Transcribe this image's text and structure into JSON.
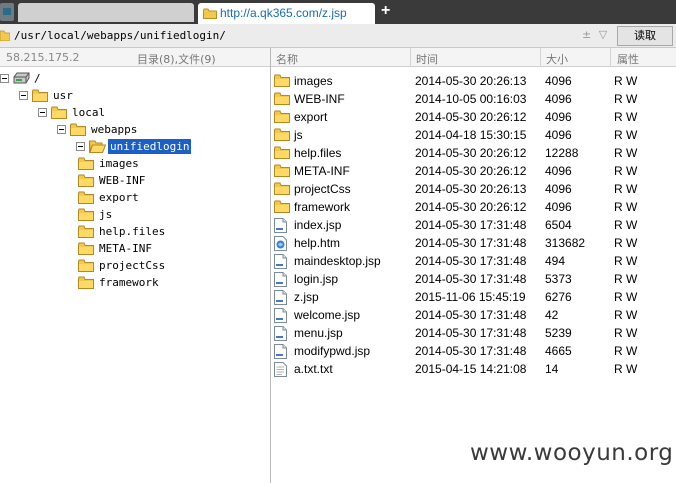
{
  "tabs": {
    "active_url": "http://a.qk365.com/z.jsp",
    "new_tab_symbol": "+"
  },
  "address": {
    "path": "/usr/local/webapps/unifiedlogin/",
    "arrows": "± ▽",
    "read_button": "读取"
  },
  "header": {
    "ip": "58.215.175.2",
    "counts": "目录(8),文件(9)",
    "columns": {
      "name": "名称",
      "time": "时间",
      "size": "大小",
      "attr": "属性"
    }
  },
  "tree": [
    {
      "label": "/",
      "icon": "drive-icon",
      "depth": 0
    },
    {
      "label": "usr",
      "icon": "folder-icon",
      "depth": 1
    },
    {
      "label": "local",
      "icon": "folder-icon",
      "depth": 2
    },
    {
      "label": "webapps",
      "icon": "folder-icon",
      "depth": 3
    },
    {
      "label": "unifiedlogin",
      "icon": "folder-open-icon",
      "depth": 4,
      "selected": true
    },
    {
      "label": "images",
      "icon": "folder-icon",
      "depth": 5
    },
    {
      "label": "WEB-INF",
      "icon": "folder-icon",
      "depth": 5
    },
    {
      "label": "export",
      "icon": "folder-icon",
      "depth": 5
    },
    {
      "label": "js",
      "icon": "folder-icon",
      "depth": 5
    },
    {
      "label": "help.files",
      "icon": "folder-icon",
      "depth": 5
    },
    {
      "label": "META-INF",
      "icon": "folder-icon",
      "depth": 5
    },
    {
      "label": "projectCss",
      "icon": "folder-icon",
      "depth": 5
    },
    {
      "label": "framework",
      "icon": "folder-icon",
      "depth": 5
    }
  ],
  "files": [
    {
      "name": "images",
      "time": "2014-05-30 20:26:13",
      "size": "4096",
      "attr": "R W",
      "icon": "folder-icon"
    },
    {
      "name": "WEB-INF",
      "time": "2014-10-05 00:16:03",
      "size": "4096",
      "attr": "R W",
      "icon": "folder-icon"
    },
    {
      "name": "export",
      "time": "2014-05-30 20:26:12",
      "size": "4096",
      "attr": "R W",
      "icon": "folder-icon"
    },
    {
      "name": "js",
      "time": "2014-04-18 15:30:15",
      "size": "4096",
      "attr": "R W",
      "icon": "folder-icon"
    },
    {
      "name": "help.files",
      "time": "2014-05-30 20:26:12",
      "size": "12288",
      "attr": "R W",
      "icon": "folder-icon"
    },
    {
      "name": "META-INF",
      "time": "2014-05-30 20:26:12",
      "size": "4096",
      "attr": "R W",
      "icon": "folder-icon"
    },
    {
      "name": "projectCss",
      "time": "2014-05-30 20:26:13",
      "size": "4096",
      "attr": "R W",
      "icon": "folder-icon"
    },
    {
      "name": "framework",
      "time": "2014-05-30 20:26:12",
      "size": "4096",
      "attr": "R W",
      "icon": "folder-icon"
    },
    {
      "name": "index.jsp",
      "time": "2014-05-30 17:31:48",
      "size": "6504",
      "attr": "R W",
      "icon": "file-icon"
    },
    {
      "name": "help.htm",
      "time": "2014-05-30 17:31:48",
      "size": "313682",
      "attr": "R W",
      "icon": "html-file-icon"
    },
    {
      "name": "maindesktop.jsp",
      "time": "2014-05-30 17:31:48",
      "size": "494",
      "attr": "R W",
      "icon": "file-icon"
    },
    {
      "name": "login.jsp",
      "time": "2014-05-30 17:31:48",
      "size": "5373",
      "attr": "R W",
      "icon": "file-icon"
    },
    {
      "name": "z.jsp",
      "time": "2015-11-06 15:45:19",
      "size": "6276",
      "attr": "R W",
      "icon": "file-icon"
    },
    {
      "name": "welcome.jsp",
      "time": "2014-05-30 17:31:48",
      "size": "42",
      "attr": "R W",
      "icon": "file-icon"
    },
    {
      "name": "menu.jsp",
      "time": "2014-05-30 17:31:48",
      "size": "5239",
      "attr": "R W",
      "icon": "file-icon"
    },
    {
      "name": "modifypwd.jsp",
      "time": "2014-05-30 17:31:48",
      "size": "4665",
      "attr": "R W",
      "icon": "file-icon"
    },
    {
      "name": "a.txt.txt",
      "time": "2015-04-15 14:21:08",
      "size": "14",
      "attr": "R W",
      "icon": "text-file-icon"
    }
  ],
  "watermark": "www.wooyun.org",
  "colors": {
    "selection": "#1c5fc6",
    "tab_link": "#1a6bb8",
    "folder": "#f2c94c",
    "tab_bar": "#3a3a3a"
  }
}
